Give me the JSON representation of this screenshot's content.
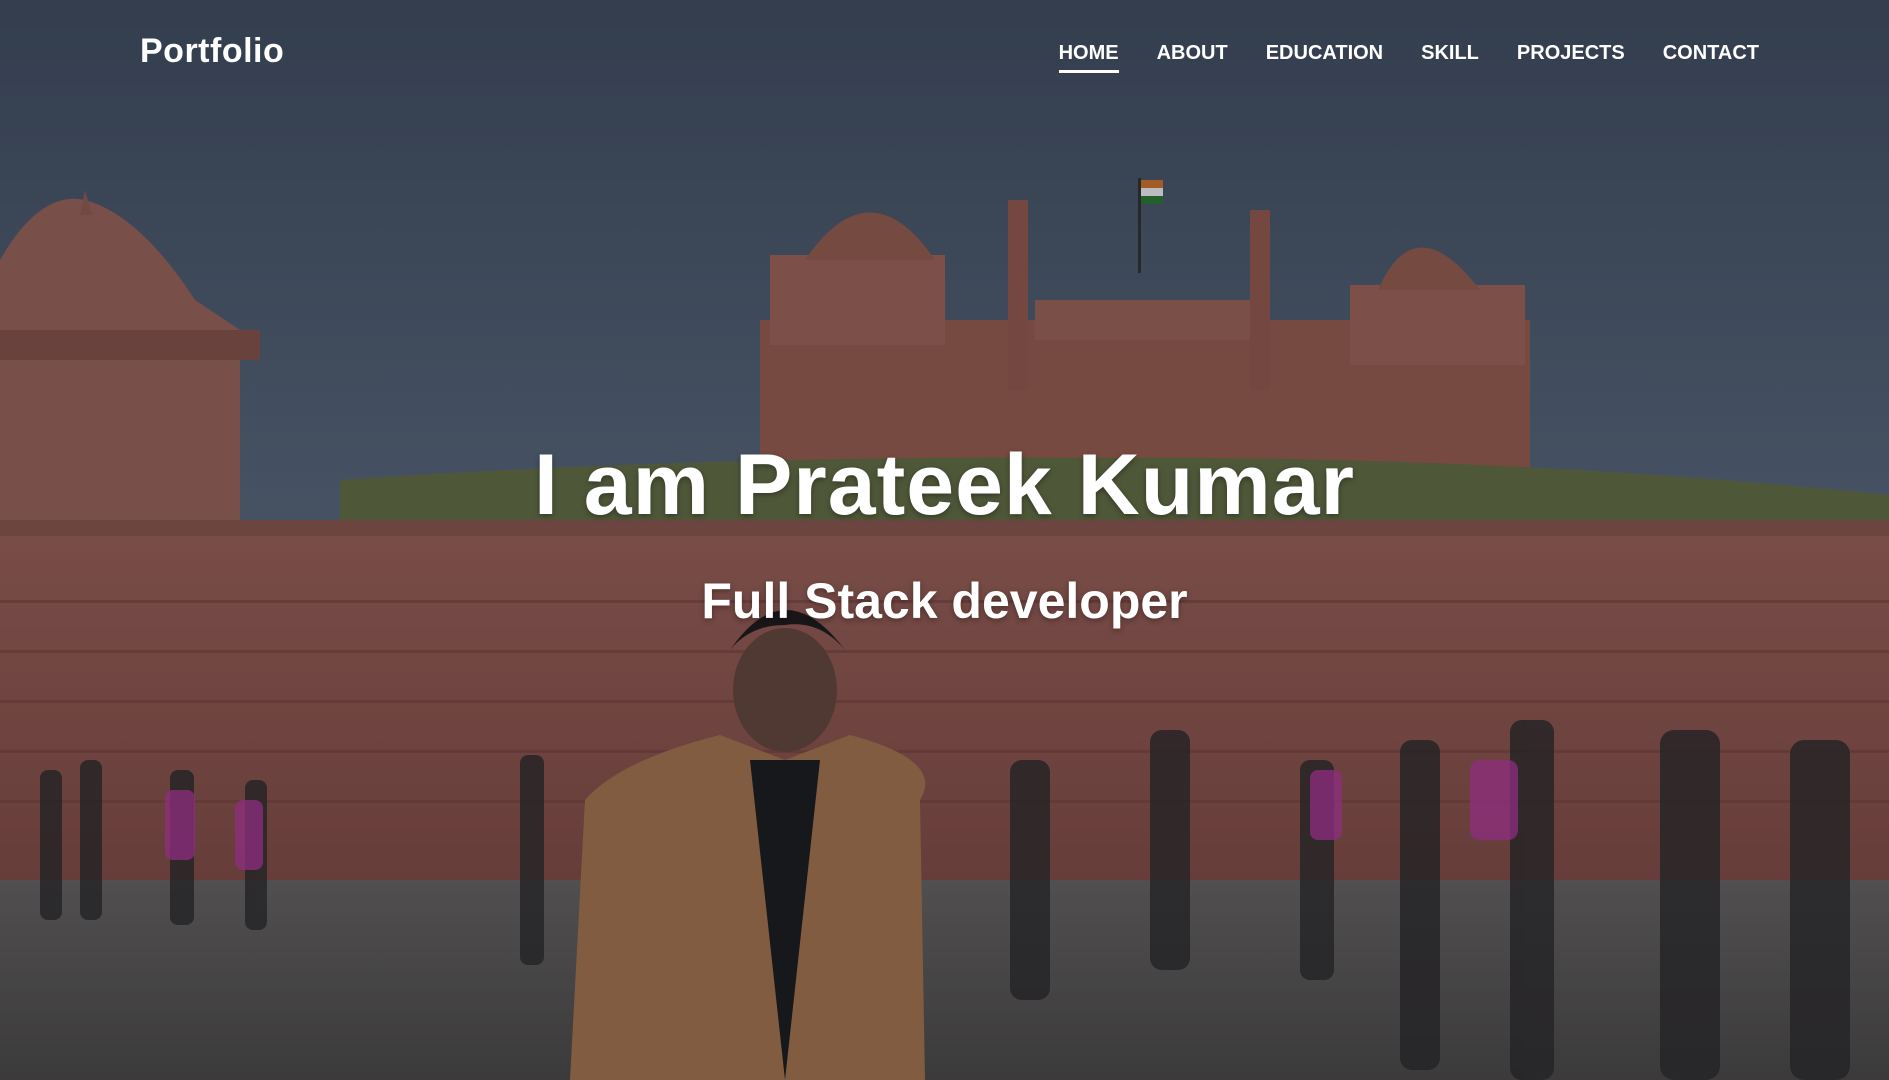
{
  "brand": {
    "label": "Portfolio"
  },
  "nav": {
    "items": [
      {
        "label": "HOME",
        "active": true
      },
      {
        "label": "ABOUT",
        "active": false
      },
      {
        "label": "EDUCATION",
        "active": false
      },
      {
        "label": "SKILL",
        "active": false
      },
      {
        "label": "PROJECTS",
        "active": false
      },
      {
        "label": "CONTACT",
        "active": false
      }
    ]
  },
  "hero": {
    "title": "I am Prateek Kumar",
    "subtitle": "Full Stack developer"
  },
  "colors": {
    "sky": "#4f5e72",
    "fort": "#9b5a4f",
    "ground": "#5e5a55",
    "text": "#ffffff"
  }
}
